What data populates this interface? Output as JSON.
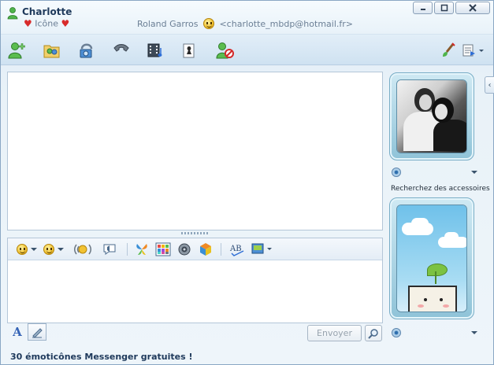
{
  "header": {
    "contact_name": "Charlotte",
    "status_text": "Icône",
    "conversation_partner": "Roland Garros",
    "partner_email": "<charlotte_mbdp@hotmail.fr>"
  },
  "window_controls": {
    "minimize_icon": "minimize-icon",
    "maximize_icon": "maximize-icon",
    "close_icon": "close-icon"
  },
  "toolbar": {
    "items": [
      "invite-contact",
      "share-folder",
      "video-call",
      "voice-call",
      "activities",
      "games",
      "block-contact",
      "theme-brush",
      "show-menu"
    ]
  },
  "format_bar": {
    "items": [
      "emoticon",
      "wink",
      "nudge",
      "voice-clip",
      "ink",
      "backgrounds",
      "sound",
      "games-bar",
      "spell-check",
      "activity-share"
    ]
  },
  "compose": {
    "value": "",
    "send_label": "Envoyer"
  },
  "right_panel": {
    "accessories_link": "Recherchez des accessoires"
  },
  "footer": {
    "ad_text": "30 émoticônes Messenger gratuites !"
  },
  "colors": {
    "title_text": "#1e395b",
    "subtle_text": "#6b7f95",
    "border": "#b4c6d8",
    "heart": "#d82b2b"
  }
}
